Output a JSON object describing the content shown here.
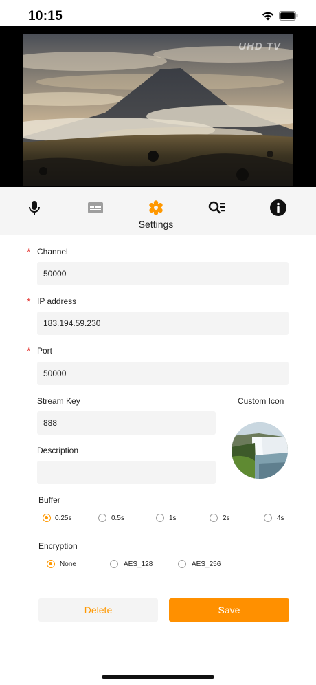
{
  "status": {
    "time": "10:15"
  },
  "video": {
    "logo_text": "UHD TV"
  },
  "toolbar": {
    "items": [
      {
        "icon": "microphone-icon"
      },
      {
        "icon": "subtitles-icon"
      },
      {
        "icon": "gear-icon",
        "label": "Settings",
        "active": true
      },
      {
        "icon": "search-list-icon"
      },
      {
        "icon": "info-icon"
      }
    ],
    "active_color": "#ff9800"
  },
  "form": {
    "channel": {
      "label": "Channel",
      "value": "50000",
      "required": "*"
    },
    "ip": {
      "label": "IP address",
      "value": "183.194.59.230",
      "required": "*"
    },
    "port": {
      "label": "Port",
      "value": "50000",
      "required": "*"
    },
    "stream_key": {
      "label": "Stream Key",
      "value": "888"
    },
    "custom_icon": {
      "label": "Custom Icon"
    },
    "description": {
      "label": "Description",
      "value": ""
    },
    "buffer": {
      "label": "Buffer",
      "options": [
        "0.25s",
        "0.5s",
        "1s",
        "2s",
        "4s"
      ],
      "selected": "0.25s"
    },
    "encryption": {
      "label": "Encryption",
      "options": [
        "None",
        "AES_128",
        "AES_256"
      ],
      "selected": "None"
    }
  },
  "actions": {
    "delete_label": "Delete",
    "save_label": "Save"
  },
  "colors": {
    "accent": "#ff9000",
    "required": "#e53935"
  }
}
